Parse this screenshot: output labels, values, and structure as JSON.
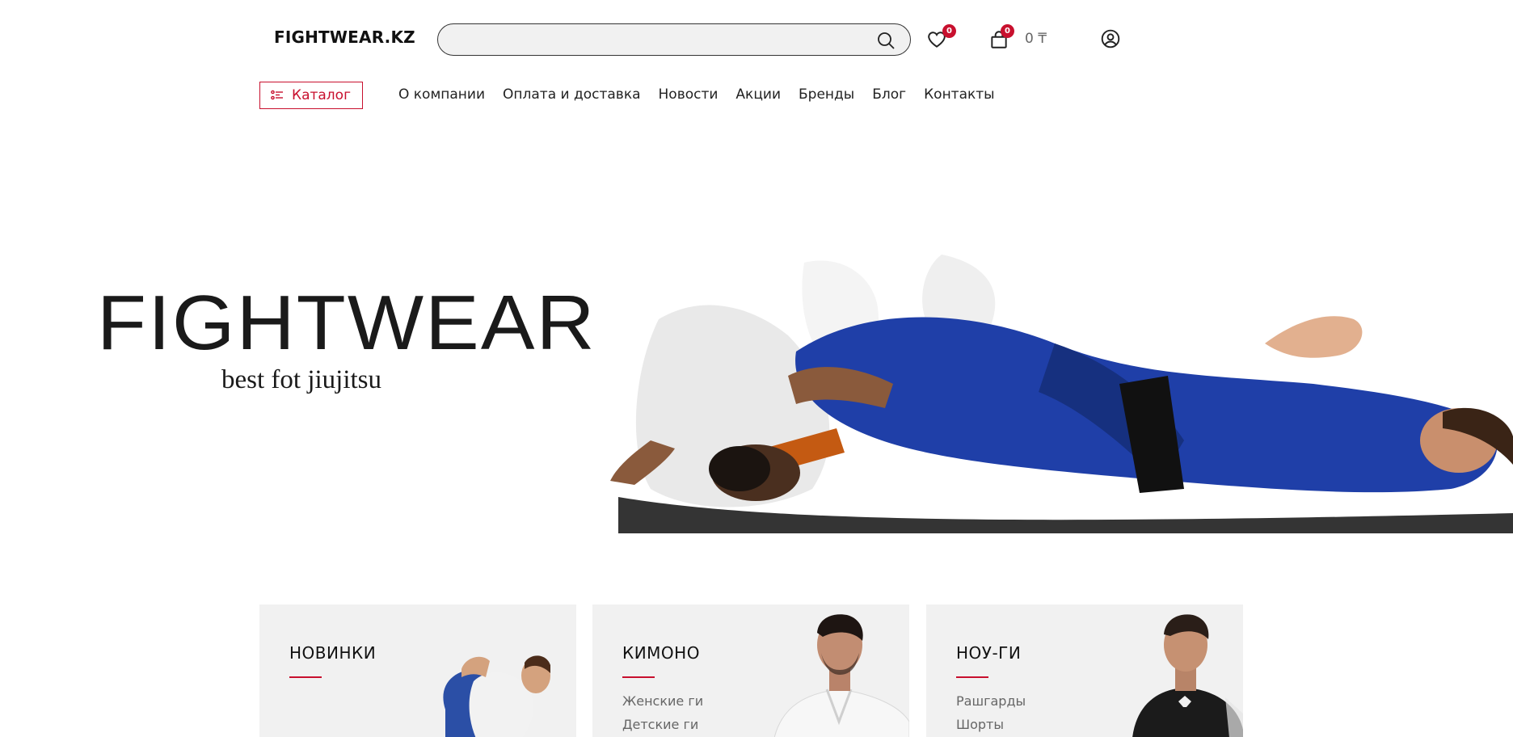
{
  "header": {
    "logo": "FIGHTWEAR.KZ",
    "search_placeholder": "",
    "wishlist_count": "0",
    "cart_count": "0",
    "cart_total": "0 ₸"
  },
  "nav": {
    "catalog_label": "Каталог",
    "items": [
      "О компании",
      "Оплата и доставка",
      "Новости",
      "Акции",
      "Бренды",
      "Блог",
      "Контакты"
    ]
  },
  "hero": {
    "title": "FIGHTWEAR",
    "subtitle": "best fot jiujitsu"
  },
  "cards": [
    {
      "title": "НОВИНКИ",
      "links": []
    },
    {
      "title": "КИМОНО",
      "links": [
        "Женские ги",
        "Детские ги"
      ]
    },
    {
      "title": "НОУ-ГИ",
      "links": [
        "Рашгарды",
        "Шорты"
      ]
    }
  ],
  "colors": {
    "accent": "#c8102e",
    "card_bg": "#f1f1f1",
    "gi_blue": "#1f3fa8"
  }
}
